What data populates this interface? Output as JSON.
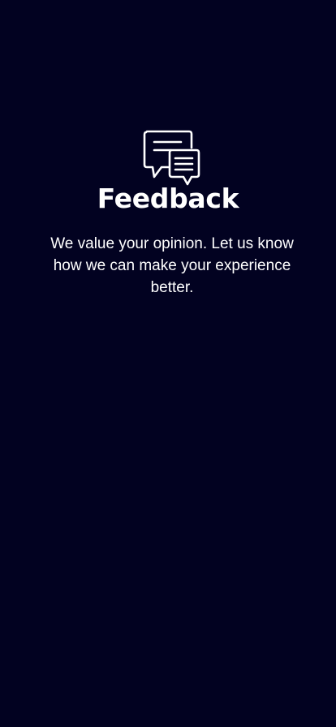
{
  "theme": {
    "background": "#020221",
    "text": "#ffffff"
  },
  "header": {
    "icon": "feedback-chat-icon",
    "title": "Feedback",
    "description": "We value your opinion. Let us know how we can make your experience better."
  }
}
